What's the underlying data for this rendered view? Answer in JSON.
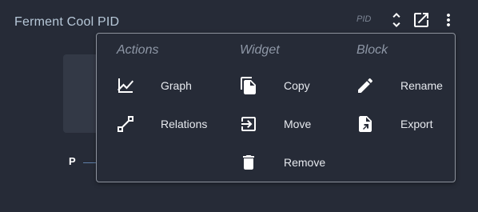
{
  "widget": {
    "title": "Ferment Cool PID",
    "type_label": "PID",
    "p_label": "P"
  },
  "menu": {
    "columns": [
      {
        "heading": "Actions",
        "items": [
          {
            "label": "Graph",
            "icon": "chart-line-icon"
          },
          {
            "label": "Relations",
            "icon": "relations-icon"
          }
        ]
      },
      {
        "heading": "Widget",
        "items": [
          {
            "label": "Copy",
            "icon": "copy-icon"
          },
          {
            "label": "Move",
            "icon": "move-icon"
          },
          {
            "label": "Remove",
            "icon": "trash-icon"
          }
        ]
      },
      {
        "heading": "Block",
        "items": [
          {
            "label": "Rename",
            "icon": "pencil-icon"
          },
          {
            "label": "Export",
            "icon": "export-file-icon"
          }
        ]
      }
    ]
  },
  "colors": {
    "background": "#262b37",
    "title": "#b7c8d8",
    "menu_border": "#8d939d",
    "heading": "#8e97a6",
    "text": "#e6e9ee"
  }
}
